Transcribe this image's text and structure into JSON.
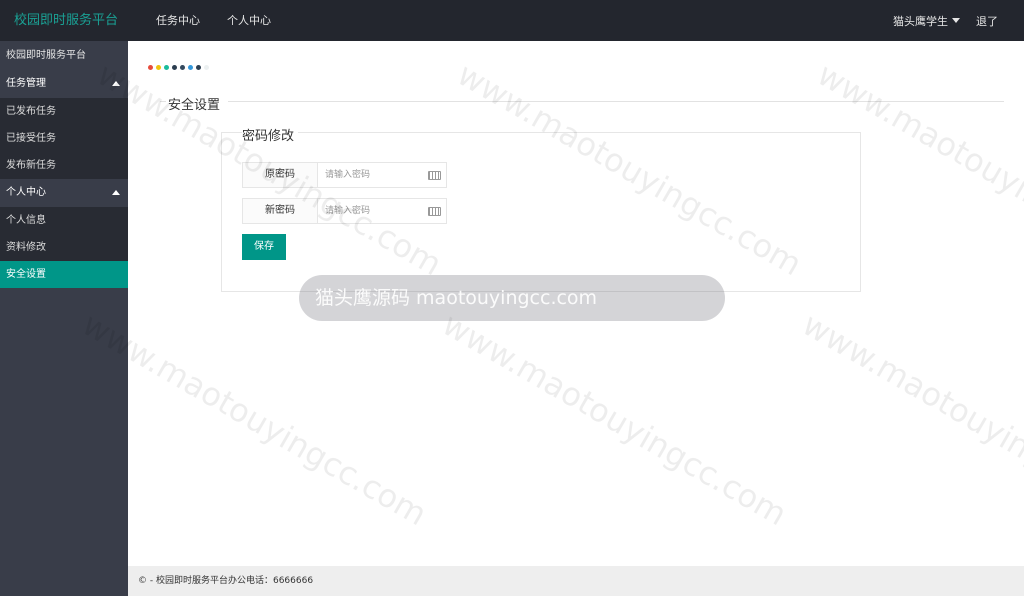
{
  "topbar": {
    "logo": "校园即时服务平台",
    "nav": [
      "任务中心",
      "个人中心"
    ],
    "user": "猫头鹰学生",
    "logout": "退了"
  },
  "sidebar": {
    "title": "校园即时服务平台",
    "groups": [
      {
        "label": "任务管理",
        "items": [
          "已发布任务",
          "已接受任务",
          "发布新任务"
        ]
      },
      {
        "label": "个人中心",
        "items": [
          "个人信息",
          "资料修改",
          "安全设置"
        ]
      }
    ],
    "active_item": "安全设置"
  },
  "main": {
    "dot_colors": [
      "#e74c3c",
      "#f1c40f",
      "#1abc9c",
      "#2c3e50",
      "#34495e",
      "#3498db",
      "#2c3e50",
      "#ecf0f1"
    ],
    "section_title": "安全设置",
    "legend": "密码修改",
    "fields": [
      {
        "label": "原密码",
        "placeholder": "请输入密码"
      },
      {
        "label": "新密码",
        "placeholder": "请输入密码"
      }
    ],
    "save_label": "保存"
  },
  "footer": {
    "text": "© - 校园即时服务平台办公电话：6666666"
  },
  "watermark": {
    "text": "www.maotouyingcc.com",
    "brand": "©猫头鹰源码",
    "bar_text": "猫头鹰源码 maotouyingcc.com"
  },
  "colors": {
    "accent": "#009688",
    "logo": "#1aa094",
    "topbar": "#23262e",
    "sidebar": "#393d49"
  }
}
